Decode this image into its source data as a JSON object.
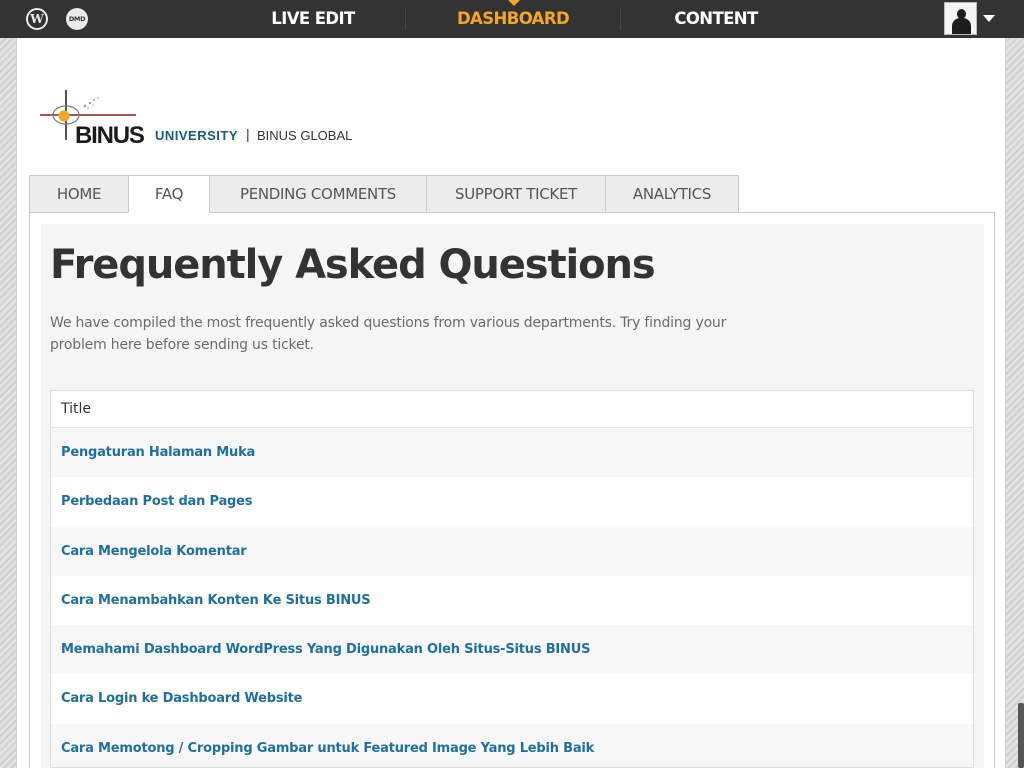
{
  "topbar": {
    "wp_icon": "wordpress-icon",
    "dmd_icon": "dmd-icon",
    "dmd_text": "DMD",
    "nav": [
      {
        "label": "LIVE EDIT",
        "active": false
      },
      {
        "label": "DASHBOARD",
        "active": true
      },
      {
        "label": "CONTENT",
        "active": false
      }
    ],
    "active_color": "#f5a623"
  },
  "logo": {
    "brand": "BINUS",
    "university": "UNIVERSITY",
    "separator": "|",
    "subsite": "BINUS GLOBAL"
  },
  "tabs": [
    {
      "label": "HOME",
      "active": false
    },
    {
      "label": "FAQ",
      "active": true
    },
    {
      "label": "PENDING COMMENTS",
      "active": false
    },
    {
      "label": "SUPPORT TICKET",
      "active": false
    },
    {
      "label": "ANALYTICS",
      "active": false
    }
  ],
  "main": {
    "title": "Frequently Asked Questions",
    "intro": "We have compiled the most frequently asked questions from various departments. Try finding your problem here before sending us ticket.",
    "table": {
      "header": "Title",
      "rows": [
        "Pengaturan Halaman Muka",
        "Perbedaan Post dan Pages",
        "Cara Mengelola Komentar",
        "Cara Menambahkan Konten Ke Situs BINUS",
        "Memahami Dashboard WordPress Yang Digunakan Oleh Situs-Situs BINUS",
        "Cara Login ke Dashboard Website",
        "Cara Memotong / Cropping Gambar untuk Featured Image Yang Lebih Baik"
      ]
    }
  },
  "colors": {
    "topbar_bg": "#333333",
    "link": "#1e6fa3",
    "brand_blue": "#155a8a"
  }
}
